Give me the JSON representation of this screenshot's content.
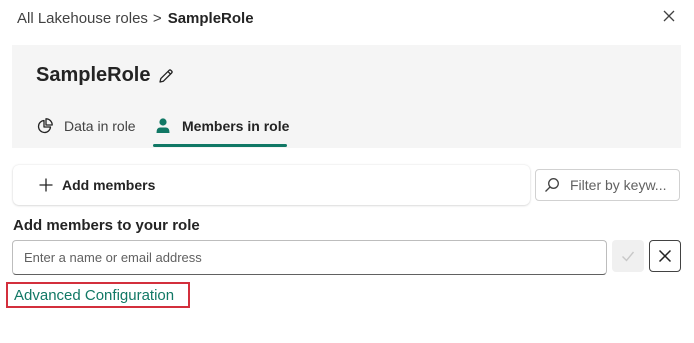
{
  "breadcrumb": {
    "parent": "All Lakehouse roles",
    "separator": ">",
    "current": "SampleRole"
  },
  "role": {
    "name": "SampleRole"
  },
  "tabs": [
    {
      "label": "Data in role",
      "icon": "pie-chart-icon",
      "selected": false
    },
    {
      "label": "Members in role",
      "icon": "person-icon",
      "selected": true
    }
  ],
  "toolbar": {
    "add_members_label": "Add members",
    "filter_placeholder": "Filter by keyw..."
  },
  "add_members_section": {
    "title": "Add members to your role",
    "input_placeholder": "Enter a name or email address",
    "input_value": ""
  },
  "advanced_configuration_label": "Advanced Configuration",
  "colors": {
    "accent": "#117865",
    "highlight_border": "#d32f3c",
    "panel_background": "#f5f5f5"
  }
}
